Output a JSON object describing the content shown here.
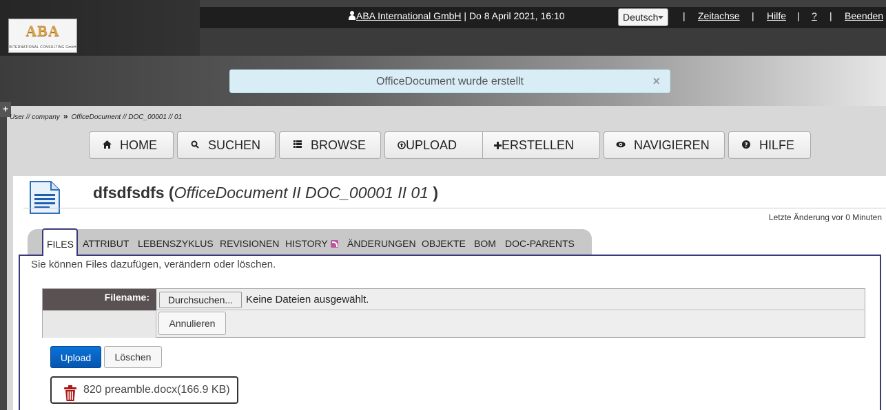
{
  "header": {
    "logo_text": "ABA",
    "logo_subtext": "INTERNATIONAL CONSULTING GmbH",
    "user_link": "ABA International GmbH",
    "datetime": " | Do 8 April 2021, 16:10",
    "language": "Deutsch",
    "nav": {
      "timeline": "Zeitachse",
      "help": "Hilfe",
      "question": "?",
      "quit": "Beenden",
      "separator": "|"
    }
  },
  "alert": {
    "message": "OfficeDocument wurde erstellt",
    "close": "×"
  },
  "sidebar_toggle": "+",
  "breadcrumb": {
    "part1": "User // company",
    "separator": "»",
    "part2": "OfficeDocument // DOC_00001 // 01"
  },
  "main_nav": {
    "home": "HOME",
    "search": "SUCHEN",
    "browse": "BROWSE",
    "upload": "UPLOAD",
    "create": "ERSTELLEN",
    "navigate": "NAVIGIEREN",
    "help": "HILFE"
  },
  "document": {
    "name": "dfsdfsdfs",
    "open_paren": " (",
    "type_ref": "OfficeDocument II  DOC_00001 II  01",
    "close_paren": " )",
    "last_change": "Letzte Änderung vor 0 Minuten"
  },
  "tabs": [
    "FILES",
    "ATTRIBUT",
    "LEBENSZYKLUS",
    "REVISIONEN",
    "HISTORY",
    "ÄNDERUNGEN",
    "OBJEKTE",
    "BOM",
    "DOC-PARENTS"
  ],
  "files_tab": {
    "hint": "Sie können Files dazufügen, verändern oder löschen.",
    "filename_label": "Filename:",
    "browse_button": "Durchsuchen...",
    "no_file": "Keine Dateien ausgewählt.",
    "cancel_button": "Annulieren",
    "upload_button": "Upload",
    "delete_button": "Löschen",
    "file_entry": "820 preamble.docx(166.9 KB)"
  },
  "colors": {
    "alert_bg": "#d9edf7",
    "upload_blue": "#0a72d8",
    "tab_border": "#3a3a7a",
    "trash_red": "#b01818"
  }
}
